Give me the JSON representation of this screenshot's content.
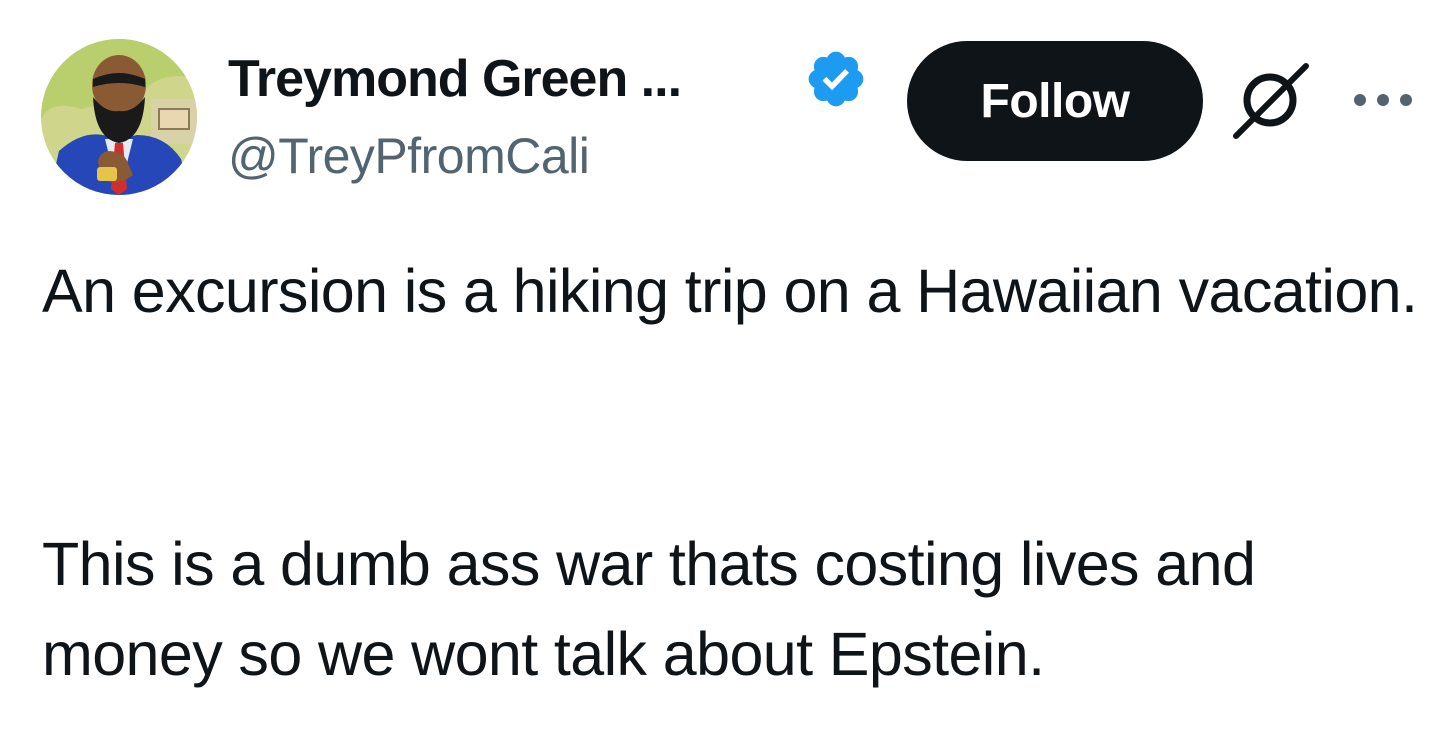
{
  "author": {
    "display_name": "Treymond Green ...",
    "handle": "@TreyPfromCali",
    "verified": true,
    "avatar_icon": "illustrated-bearded-man-in-blue-suit"
  },
  "actions": {
    "follow_label": "Follow",
    "grok_icon": "grok-icon",
    "more_icon": "more-icon"
  },
  "tweet": {
    "paragraphs": [
      "An excursion is a hiking trip on a Hawaiian vacation.",
      "This is a dumb ass war thats costing lives and money so we wont talk about Epstein."
    ]
  },
  "colors": {
    "text": "#0f1419",
    "secondary_text": "#536471",
    "verified_badge": "#1d9bf0",
    "follow_button_bg": "#0f1419",
    "follow_button_text": "#ffffff"
  }
}
